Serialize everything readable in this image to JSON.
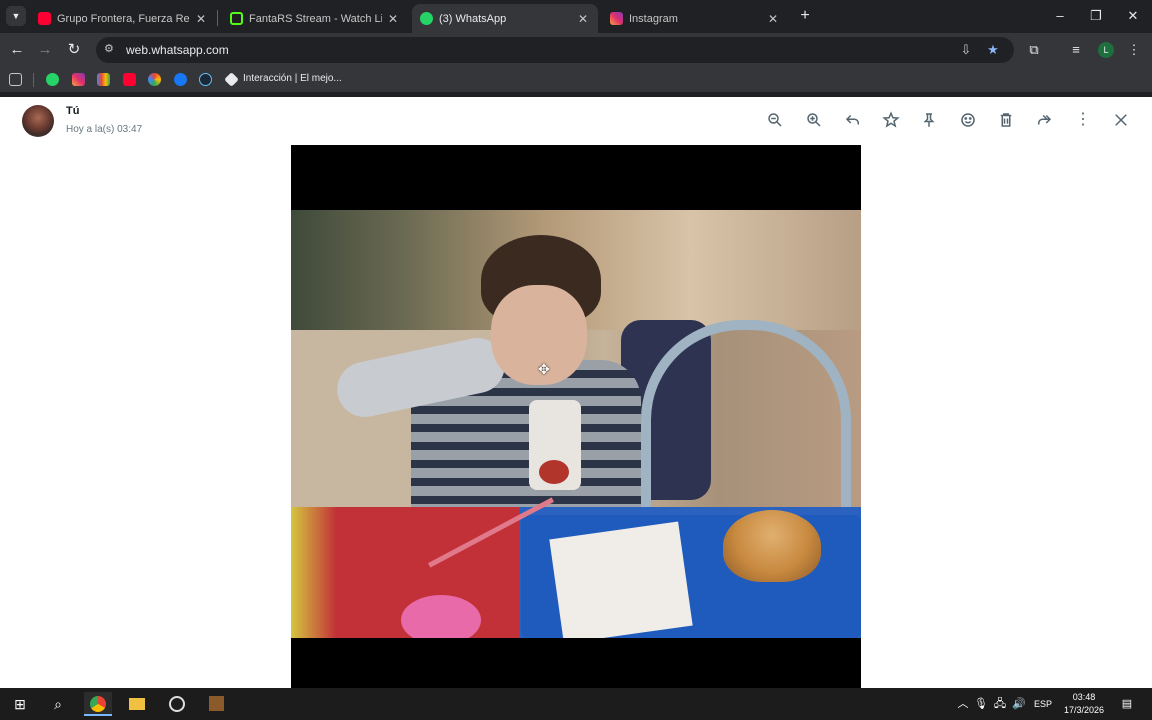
{
  "browser": {
    "tabs": [
      {
        "title": "Grupo Frontera, Fuerza Regida",
        "icon": "youtube-icon",
        "active": false
      },
      {
        "title": "FantaRS Stream - Watch Live on",
        "icon": "kick-icon",
        "active": false
      },
      {
        "title": "(3) WhatsApp",
        "icon": "whatsapp-icon",
        "active": true
      },
      {
        "title": "Instagram",
        "icon": "instagram-icon",
        "active": false
      }
    ],
    "url": "web.whatsapp.com",
    "profile_initial": "L",
    "bookmark_label": "Interacción | El mejo..."
  },
  "viewer": {
    "sender": "Tú",
    "timestamp": "Hoy a la(s) 03:47",
    "actions": [
      "zoom-out",
      "zoom-in",
      "reply",
      "star",
      "pin",
      "react",
      "delete",
      "forward",
      "menu",
      "close"
    ]
  },
  "taskbar": {
    "language": "ESP",
    "time": "03:48",
    "date": "17/3/2026"
  },
  "colors": {
    "chrome_bg": "#202124",
    "toolbar_bg": "#35363a",
    "viewer_icon": "#54656f",
    "accent_star": "#8ab4f8"
  }
}
